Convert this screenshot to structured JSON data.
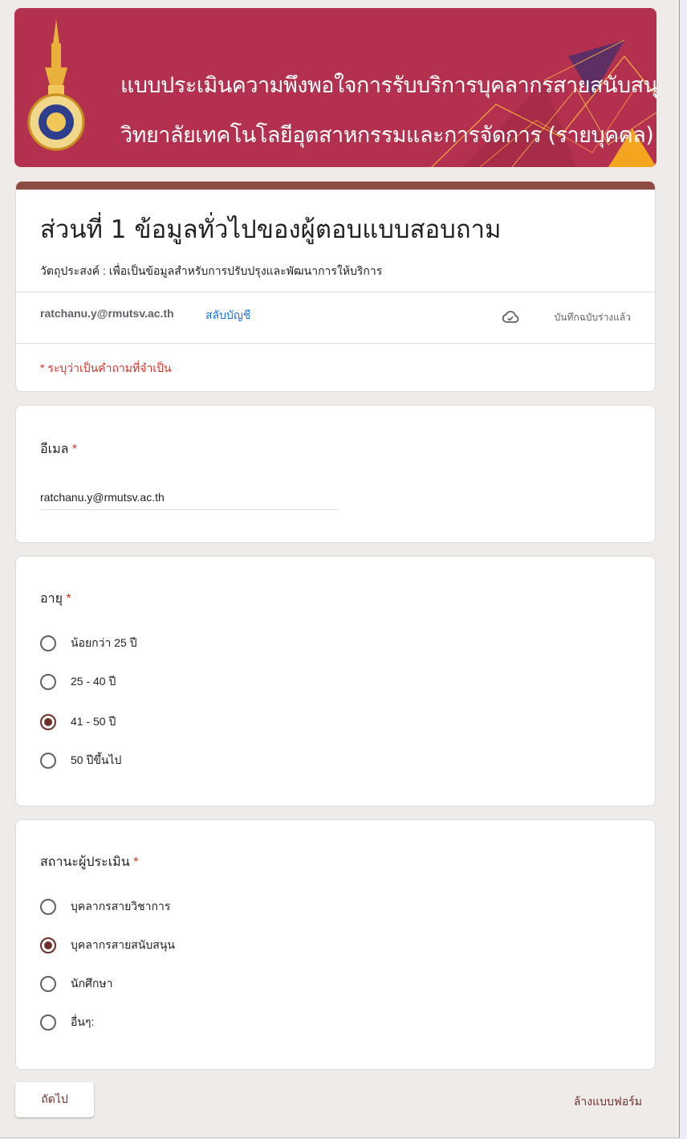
{
  "banner": {
    "line1": "แบบประเมินความพึงพอใจการรับบริการบุคลากรสายสนับสนุน",
    "line2": "วิทยาลัยเทคโนโลยีอุตสาหกรรมและการจัดการ (รายบุคคล)",
    "background_color": "#b3304f"
  },
  "header": {
    "title": "ส่วนที่ 1 ข้อมูลทั่วไปของผู้ตอบแบบสอบถาม",
    "description": "วัตถุประสงค์ : เพื่อเป็นข้อมูลสำหรับการปรับปรุงและพัฒนาการให้บริการ",
    "account_email": "ratchanu.y@rmutsv.ac.th",
    "switch_account": "สลับบัญชี",
    "saved_status": "บันทึกฉบับร่างแล้ว",
    "saved_icon": "cloud-done-icon",
    "required_note": "* ระบุว่าเป็นคำถามที่จำเป็น",
    "accent_color": "#8d4b43"
  },
  "questions": {
    "email": {
      "title": "อีเมล",
      "required_mark": "*",
      "value": "ratchanu.y@rmutsv.ac.th"
    },
    "age": {
      "title": "อายุ",
      "required_mark": "*",
      "options": [
        {
          "label": "น้อยกว่า 25 ปี",
          "selected": false
        },
        {
          "label": "25 - 40 ปี",
          "selected": false
        },
        {
          "label": "41 - 50 ปี",
          "selected": true
        },
        {
          "label": "50 ปีขึ้นไป",
          "selected": false
        }
      ]
    },
    "status": {
      "title": "สถานะผู้ประเมิน",
      "required_mark": "*",
      "options": [
        {
          "label": "บุคลากรสายวิชาการ",
          "selected": false
        },
        {
          "label": "บุคลากรสายสนับสนุน",
          "selected": true
        },
        {
          "label": "นักศึกษา",
          "selected": false
        },
        {
          "label": "อื่นๆ:",
          "selected": false
        }
      ]
    }
  },
  "footer": {
    "next_label": "ถัดไป",
    "clear_label": "ล้างแบบฟอร์ม"
  },
  "colors": {
    "required": "#d93025",
    "link": "#1a73e8",
    "radio_selected": "#6e2f2a"
  }
}
